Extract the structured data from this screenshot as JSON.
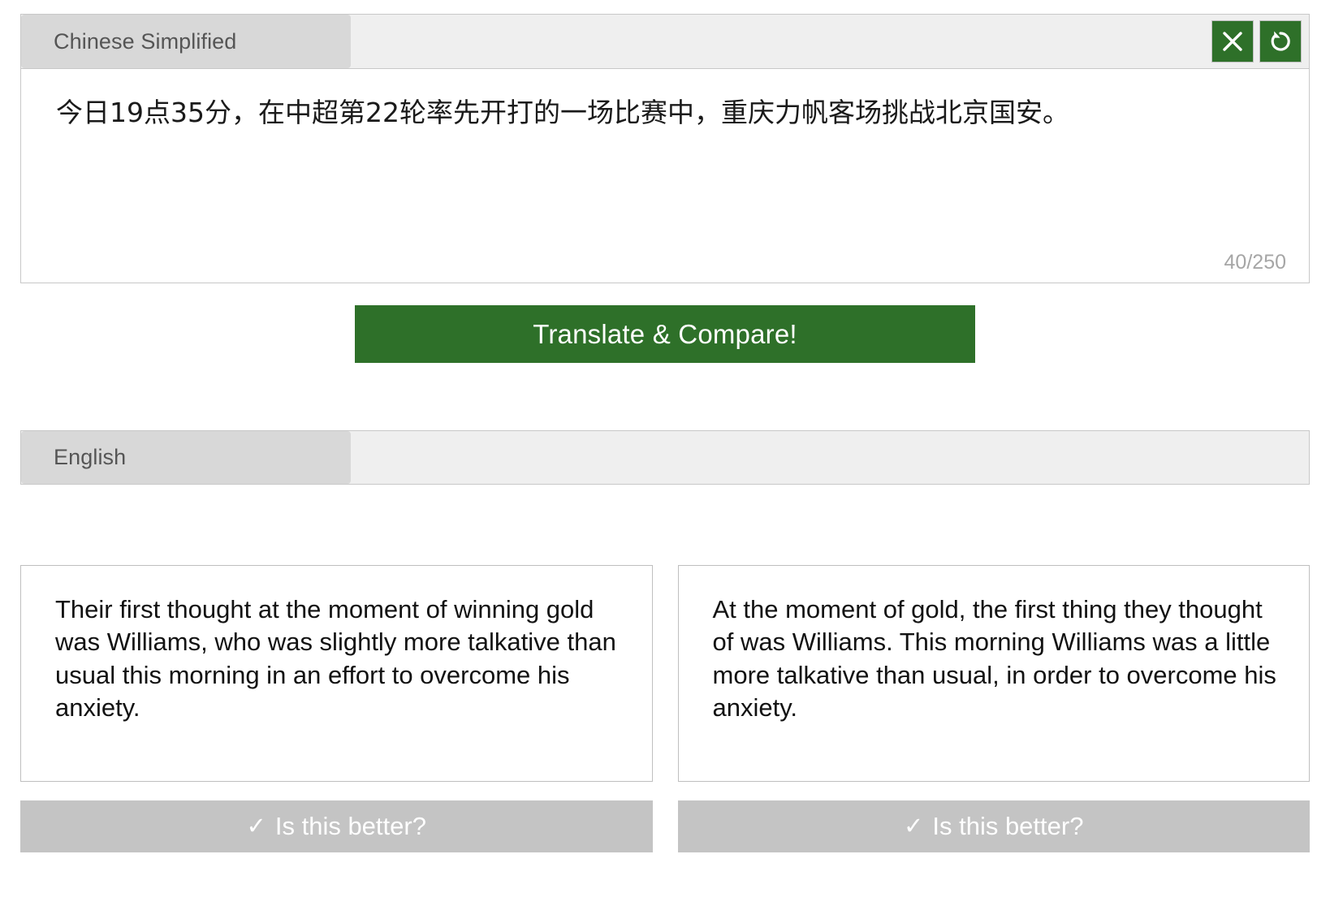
{
  "source": {
    "language_tab": "Chinese Simplified",
    "text": "今日19点35分，在中超第22轮率先开打的一场比赛中，重庆力帆客场挑战北京国安。",
    "char_counter": "40/250",
    "clear_icon": "close-x-icon",
    "reset_icon": "undo-rotate-ccw-icon"
  },
  "actions": {
    "translate_label": "Translate & Compare!"
  },
  "target": {
    "language_tab": "English"
  },
  "results": [
    {
      "text": "Their first thought at the moment of winning gold was Williams, who was slightly more talkative than usual this morning in an effort to overcome his anxiety.",
      "vote_label": "Is this better?",
      "vote_icon": "check-icon"
    },
    {
      "text": "At the moment of gold, the first thing they thought of was Williams. This morning Williams was a little more talkative than usual, in order to overcome his anxiety.",
      "vote_label": "Is this better?",
      "vote_icon": "check-icon"
    }
  ],
  "colors": {
    "accent_green": "#2e7029",
    "tab_grey": "#d8d8d8",
    "strip_grey": "#efefef",
    "button_grey": "#c4c4c4",
    "border_grey": "#c8c8c8",
    "counter_grey": "#a6a6a6"
  }
}
